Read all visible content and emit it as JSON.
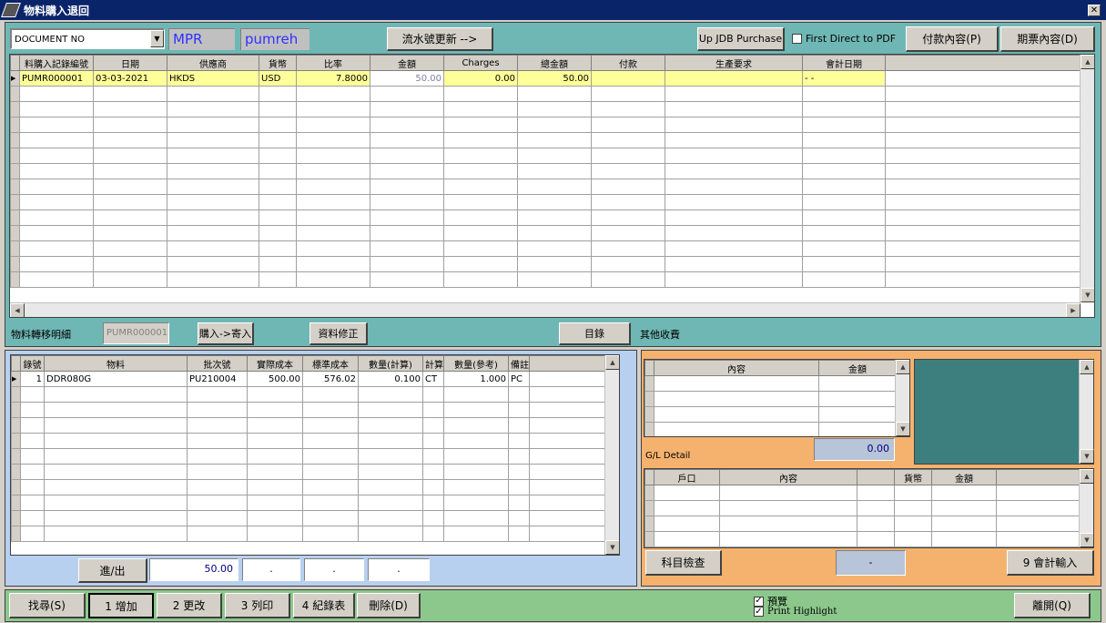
{
  "window": {
    "title": "物料購入退回"
  },
  "toolbar": {
    "doc_select": "DOCUMENT NO",
    "field1": "MPR",
    "field2": "pumreh",
    "serial_update": "流水號更新 -->",
    "up_jdb": "Up JDB Purchase",
    "first_direct": "First Direct to PDF",
    "payment_content": "付款內容(P)",
    "invoice_content": "期票內容(D)"
  },
  "main_grid": {
    "columns": [
      "料購入記錄編號",
      "日期",
      "供應商",
      "貨幣",
      "比率",
      "金額",
      "Charges",
      "總金額",
      "付款",
      "生產要求",
      "會計日期"
    ],
    "rows": [
      [
        "PUMR000001",
        "03-03-2021",
        "HKDS",
        "USD",
        "7.8000",
        "50.00",
        "0.00",
        "50.00",
        "",
        "",
        "- -"
      ]
    ]
  },
  "middle": {
    "transfer_label": "物料轉移明細",
    "transfer_no": "PUMR000001",
    "buy_to_send": "購入->寄入",
    "data_fix": "資料修正",
    "catalog": "目錄",
    "other_charges": "其他收費"
  },
  "detail_grid": {
    "columns": [
      "錄號",
      "物料",
      "批次號",
      "實際成本",
      "標準成本",
      "數量(計算)",
      "計算",
      "數量(參考)",
      "備註"
    ],
    "rows": [
      [
        "1",
        "DDR080G",
        "PU210004",
        "500.00",
        "576.02",
        "0.100",
        "CT",
        "1.000",
        "PC"
      ]
    ]
  },
  "detail_footer": {
    "in_out": "進/出",
    "total": "50.00",
    "f2": ".",
    "f3": ".",
    "f4": "."
  },
  "charges_grid": {
    "columns": [
      "內容",
      "金額"
    ],
    "total": "0.00"
  },
  "gl": {
    "label": "G/L Detail",
    "columns": [
      "戶口",
      "內容",
      "",
      "貨幣",
      "金額"
    ],
    "account_check": "科目檢查",
    "dash": "-",
    "account_input": "9 會計輸入"
  },
  "bottom": {
    "find": "找尋(S)",
    "add": "1 增加",
    "edit": "2 更改",
    "print": "3 列印",
    "records": "4 紀錄表",
    "delete": "刪除(D)",
    "preview": "預覽",
    "print_highlight": "Print Highlight",
    "exit": "離開(Q)"
  },
  "colors": {
    "title_bar": "#0a246a",
    "teal": "#6fb7b4",
    "blue_panel": "#b8d0f0",
    "orange_panel": "#f5b26e",
    "green_bar": "#8cc88c",
    "selected_row": "#ffff99",
    "dark_teal": "#3d7f7f"
  }
}
